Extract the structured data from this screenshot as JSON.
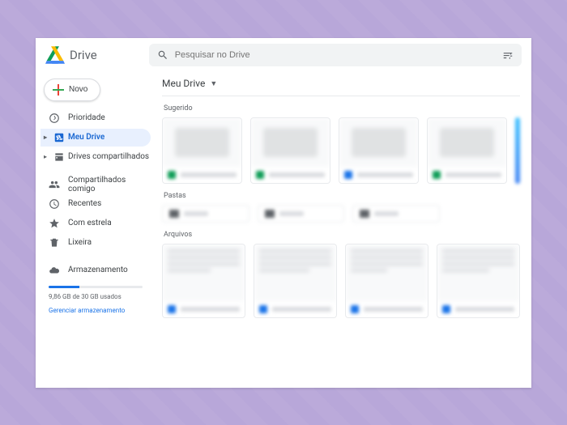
{
  "brand": {
    "name": "Drive"
  },
  "search": {
    "placeholder": "Pesquisar no Drive"
  },
  "new_button": {
    "label": "Novo"
  },
  "sidebar": {
    "priority": "Prioridade",
    "my_drive": "Meu Drive",
    "shared_drives": "Drives compartilhados",
    "shared_with_me": "Compartilhados comigo",
    "recent": "Recentes",
    "starred": "Com estrela",
    "trash": "Lixeira",
    "storage": "Armazenamento",
    "storage_used": "9,86 GB de 30 GB usados",
    "storage_manage": "Gerenciar armazenamento"
  },
  "main": {
    "breadcrumb": "Meu Drive",
    "suggested_label": "Sugerido",
    "folders_label": "Pastas",
    "files_label": "Arquivos"
  }
}
